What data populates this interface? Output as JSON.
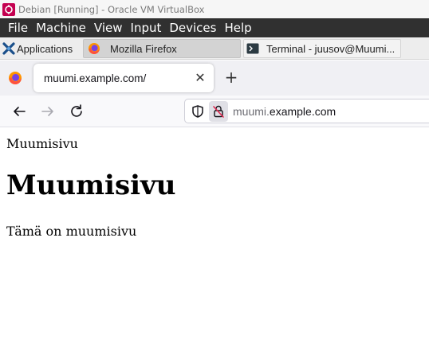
{
  "window": {
    "title": "Debian [Running] - Oracle VM VirtualBox"
  },
  "vbox_menu": {
    "items": [
      "File",
      "Machine",
      "View",
      "Input",
      "Devices",
      "Help"
    ]
  },
  "taskbar": {
    "applications_label": "Applications",
    "firefox_label": "Mozilla Firefox",
    "terminal_label": "Terminal - juusov@Muumi..."
  },
  "browser": {
    "tab_title": "muumi.example.com/",
    "close_glyph": "✕",
    "newtab_glyph": "+",
    "url_subdomain": "muumi.",
    "url_domain": "example.com"
  },
  "page": {
    "document_title": "Muumisivu",
    "heading": "Muumisivu",
    "paragraph": "Tämä on muumisivu"
  },
  "colors": {
    "vbox_menu_bg": "#303030",
    "tab_bar_bg": "#f0f0f4",
    "accent_red": "#c40050"
  },
  "icons": [
    "virtualbox-icon",
    "xfce-applications-icon",
    "firefox-icon",
    "terminal-icon",
    "back-arrow-icon",
    "forward-arrow-icon",
    "reload-icon",
    "shield-icon",
    "insecure-lock-icon",
    "close-icon",
    "plus-icon"
  ]
}
